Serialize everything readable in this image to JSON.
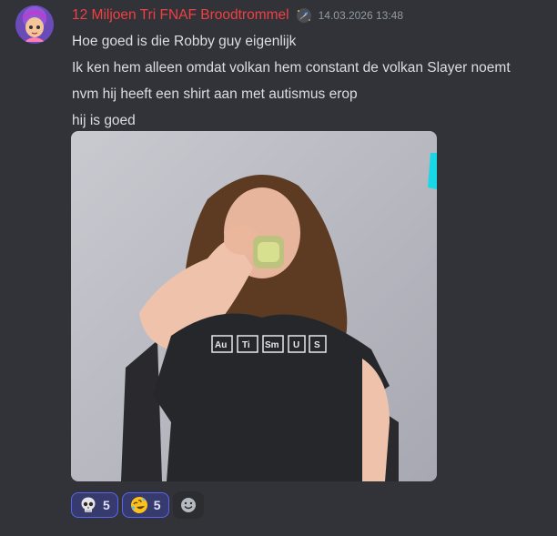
{
  "message": {
    "author": "12 Miljoen Tri FNAF Broodtrommel",
    "role_icon": "rocket-role-icon",
    "timestamp": "14.03.2026 13:48",
    "lines": [
      "Hoe goed is die Robby guy eigenlijk",
      "Ik ken hem alleen omdat volkan hem constant de volkan Slayer noemt",
      "nvm hij heeft een shirt aan met autismus erop",
      "hij is goed"
    ],
    "attachment": {
      "shirt_text": [
        "Au",
        "Ti",
        "Sm",
        "U",
        "S"
      ]
    }
  },
  "reactions": [
    {
      "emoji": "skull-emoji",
      "count": "5"
    },
    {
      "emoji": "rofl-emoji",
      "count": "5"
    }
  ],
  "add_reaction_icon": "add-reaction-smile-icon",
  "colors": {
    "background": "#313338",
    "username": "#f23f43",
    "reaction_bg": "#373a6d",
    "reaction_border": "#5865f2"
  }
}
